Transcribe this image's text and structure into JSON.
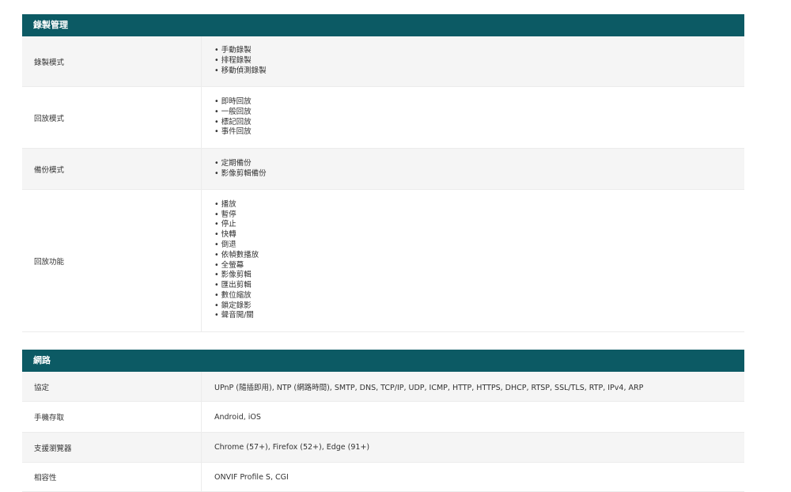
{
  "recording": {
    "header": "錄製管理",
    "rows": [
      {
        "label": "錄製模式",
        "items": [
          "手動錄製",
          "排程錄製",
          "移動偵測錄製"
        ]
      },
      {
        "label": "回放模式",
        "items": [
          "即時回放",
          "一般回放",
          "標記回放",
          "事件回放"
        ]
      },
      {
        "label": "備份模式",
        "items": [
          "定期備份",
          "影像剪輯備份"
        ]
      },
      {
        "label": "回放功能",
        "items": [
          "播放",
          "暫停",
          "停止",
          "快轉",
          "倒退",
          "依幀數播放",
          "全螢幕",
          "影像剪輯",
          "匯出剪輯",
          "數位縮放",
          "鎖定錄影",
          "聲音開/關"
        ]
      }
    ]
  },
  "network": {
    "header": "網路",
    "rows": [
      {
        "label": "協定",
        "value": "UPnP (隨插即用), NTP (網路時間), SMTP, DNS, TCP/IP, UDP, ICMP, HTTP, HTTPS, DHCP, RTSP, SSL/TLS, RTP, IPv4, ARP"
      },
      {
        "label": "手機存取",
        "value": "Android, iOS"
      },
      {
        "label": "支援瀏覽器",
        "value": "Chrome (57+), Firefox (52+), Edge (91+)"
      },
      {
        "label": "相容性",
        "value": "ONVIF Profile S, CGI"
      }
    ]
  }
}
